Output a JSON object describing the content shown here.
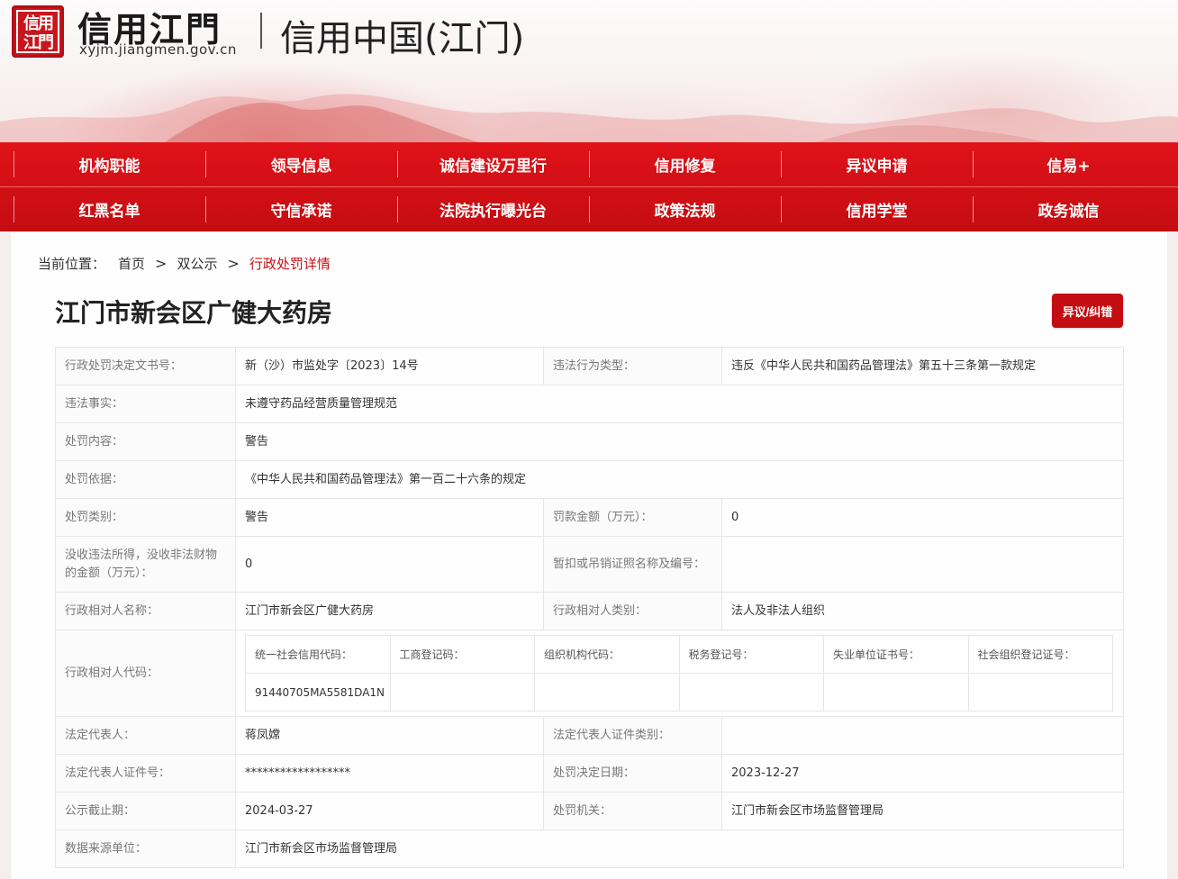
{
  "header": {
    "seal_text": "信用江門",
    "brand_name": "信用江門",
    "brand_url": "xyjm.jiangmen.gov.cn",
    "site_title": "信用中国(江门)"
  },
  "nav": {
    "row1": [
      "机构职能",
      "领导信息",
      "诚信建设万里行",
      "信用修复",
      "异议申请",
      "信易+"
    ],
    "row2": [
      "红黑名单",
      "守信承诺",
      "法院执行曝光台",
      "政策法规",
      "信用学堂",
      "政务诚信"
    ]
  },
  "breadcrumb": {
    "label": "当前位置：",
    "items": [
      "首页",
      "双公示",
      "行政处罚详情"
    ],
    "separator": ">"
  },
  "page_title": "江门市新会区广健大药房",
  "dispute_button": "异议/纠错",
  "details": {
    "decision_no_label": "行政处罚决定文书号：",
    "decision_no": "新（沙）市监处字〔2023〕14号",
    "violation_type_label": "违法行为类型：",
    "violation_type": "违反《中华人民共和国药品管理法》第五十三条第一款规定",
    "facts_label": "违法事实：",
    "facts": "未遵守药品经营质量管理规范",
    "content_label": "处罚内容：",
    "content": "警告",
    "basis_label": "处罚依据：",
    "basis": "《中华人民共和国药品管理法》第一百二十六条的规定",
    "category_label": "处罚类别：",
    "category": "警告",
    "fine_label": "罚款金额（万元）：",
    "fine": "0",
    "confiscation_label": "没收违法所得，没收非法财物的金额（万元）：",
    "confiscation": "0",
    "license_label": "暂扣或吊销证照名称及编号：",
    "license": "",
    "party_name_label": "行政相对人名称：",
    "party_name": "江门市新会区广健大药房",
    "party_type_label": "行政相对人类别：",
    "party_type": "法人及非法人组织",
    "party_code_label": "行政相对人代码：",
    "code_headers": [
      "统一社会信用代码：",
      "工商登记码：",
      "组织机构代码：",
      "税务登记号：",
      "失业单位证书号：",
      "社会组织登记证号："
    ],
    "code_values": [
      "91440705MA5581DA1N",
      "",
      "",
      "",
      "",
      ""
    ],
    "legal_rep_label": "法定代表人：",
    "legal_rep": "蒋凤嫦",
    "legal_id_type_label": "法定代表人证件类别：",
    "legal_id_type": "",
    "legal_id_no_label": "法定代表人证件号：",
    "legal_id_no": "******************",
    "decision_date_label": "处罚决定日期：",
    "decision_date": "2023-12-27",
    "publicity_end_label": "公示截止期：",
    "publicity_end": "2024-03-27",
    "authority_label": "处罚机关：",
    "authority": "江门市新会区市场监督管理局",
    "source_label": "数据来源单位：",
    "source": "江门市新会区市场监督管理局"
  },
  "colors": {
    "brand_red": "#c40d12",
    "nav_red": "#e01218"
  }
}
